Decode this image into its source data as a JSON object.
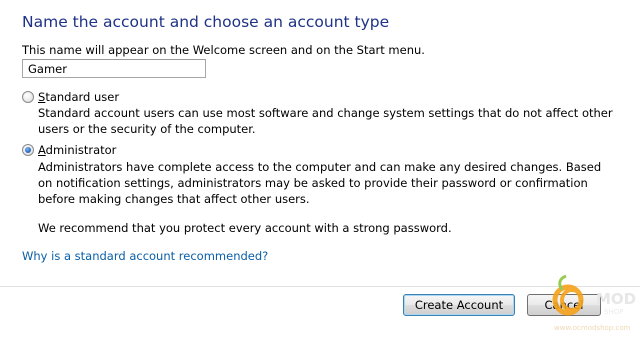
{
  "header": {
    "title": "Name the account and choose an account type"
  },
  "name_section": {
    "description": "This name will appear on the Welcome screen and on the Start menu.",
    "input_value": "Gamer"
  },
  "account_types": {
    "standard": {
      "label_mnemonic": "S",
      "label_rest": "tandard user",
      "description": "Standard account users can use most software and change system settings that do not affect other users or the security of the computer.",
      "selected": false
    },
    "administrator": {
      "label_mnemonic": "A",
      "label_rest": "dministrator",
      "description": "Administrators have complete access to the computer and can make any desired changes. Based on notification settings, administrators may be asked to provide their password or confirmation before making changes that affect other users.",
      "recommendation": "We recommend that you protect every account with a strong password.",
      "selected": true
    }
  },
  "help_link": {
    "text": "Why is a standard account recommended?"
  },
  "buttons": {
    "create_label": "Create Account",
    "cancel_label": "Cancel"
  },
  "watermark": {
    "logo_text": "OC",
    "brand_text": "MOD",
    "subtext": "SHOP",
    "url_text": "www.ocmodshop.com"
  },
  "colors": {
    "heading": "#1e3287",
    "link": "#0a5fa8",
    "watermark_orange": "#f6a21a",
    "watermark_green": "#8dc63f"
  }
}
